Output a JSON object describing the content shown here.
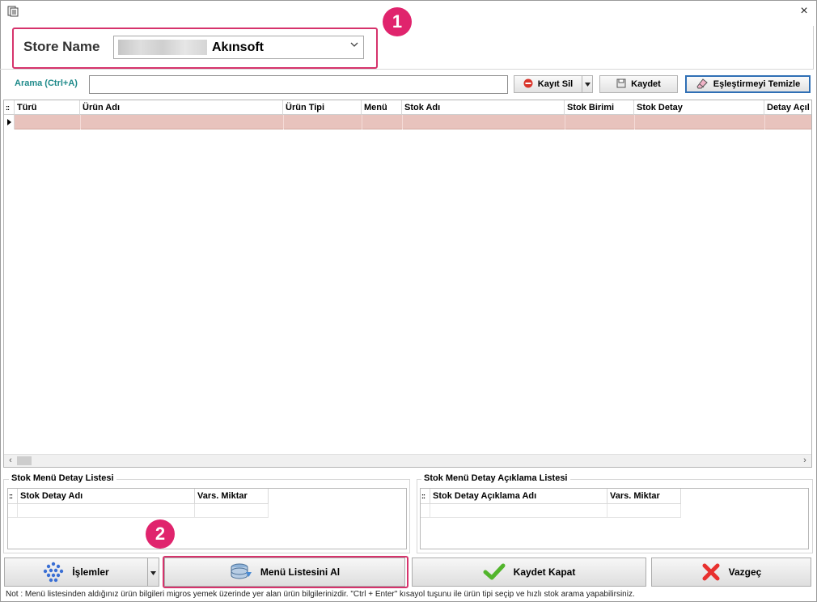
{
  "window": {
    "close_glyph": "×"
  },
  "annotations": {
    "badge_1": "1",
    "badge_2": "2"
  },
  "store": {
    "label": "Store Name",
    "value": "Akınsoft"
  },
  "search": {
    "label": "Arama (Ctrl+A)",
    "value": ""
  },
  "toolbar": {
    "delete_label": "Kayıt Sil",
    "save_label": "Kaydet",
    "clear_label": "Eşleştirmeyi Temizle"
  },
  "grid": {
    "columns": [
      "Türü",
      "Ürün Adı",
      "Ürün Tipi",
      "Menü",
      "Stok Adı",
      "Stok Birimi",
      "Stok Detay",
      "Detay Açıl"
    ]
  },
  "detail_list": {
    "title": "Stok Menü Detay Listesi",
    "columns": [
      "Stok Detay Adı",
      "Vars. Miktar"
    ]
  },
  "desc_list": {
    "title": "Stok Menü Detay Açıklama Listesi",
    "columns": [
      "Stok Detay Açıklama Adı",
      "Vars. Miktar"
    ]
  },
  "buttons": {
    "islemler": "İşlemler",
    "menu_listesi": "Menü Listesini Al",
    "kaydet_kapat": "Kaydet Kapat",
    "vazgec": "Vazgeç"
  },
  "note": "Not :  Menü listesinden aldığınız ürün bilgileri migros yemek üzerinde yer alan ürün bilgilerinizdir. \"Ctrl + Enter\" kısayol tuşunu ile ürün tipi seçip ve hızlı stok arama yapabilirsiniz.",
  "colors": {
    "accent_pink": "#e0246d",
    "selected_row": "#e8c3bd",
    "search_label": "#1e8a8a",
    "clear_btn_border": "#2f6fb5"
  }
}
